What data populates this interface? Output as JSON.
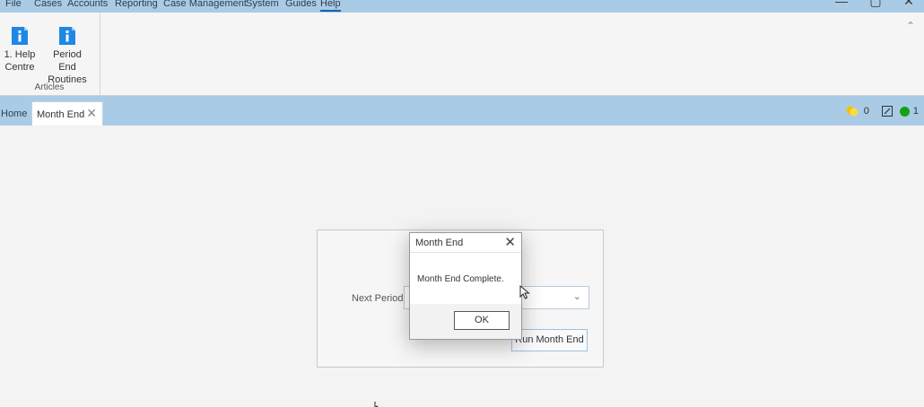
{
  "menu": {
    "items": [
      "File",
      "Cases",
      "Accounts",
      "Reporting",
      "Case Management",
      "System",
      "Guides",
      "Help"
    ],
    "active_item": "Help"
  },
  "window_controls": {
    "minimize_icon": "—",
    "maximize_icon": "▢",
    "close_icon": "✕"
  },
  "ribbon": {
    "buttons": [
      {
        "label": "1. Help\nCentre",
        "icon": "document-info-icon"
      },
      {
        "label": "Period\nEnd Routines",
        "icon": "document-info-icon"
      }
    ],
    "group_label": "Articles",
    "collapse_icon": "⌃"
  },
  "tabs": {
    "home_label": "Home",
    "active_label": "Month End",
    "close_icon": "✕"
  },
  "status": {
    "warning_count": "0",
    "ok_count": "1",
    "warning_color": "#f2c200",
    "ok_color": "#16a016"
  },
  "month_end_panel": {
    "period_label": "Next Period:",
    "period_value": "",
    "dropdown_icon": "⌄",
    "run_button_label": "Run Month End"
  },
  "dialog": {
    "title": "Month End",
    "close_icon": "✕",
    "message": "Month End Complete.",
    "ok_label": "OK"
  },
  "colors": {
    "menubar_bg": "#a9cbe6",
    "accent": "#1a62b0"
  }
}
